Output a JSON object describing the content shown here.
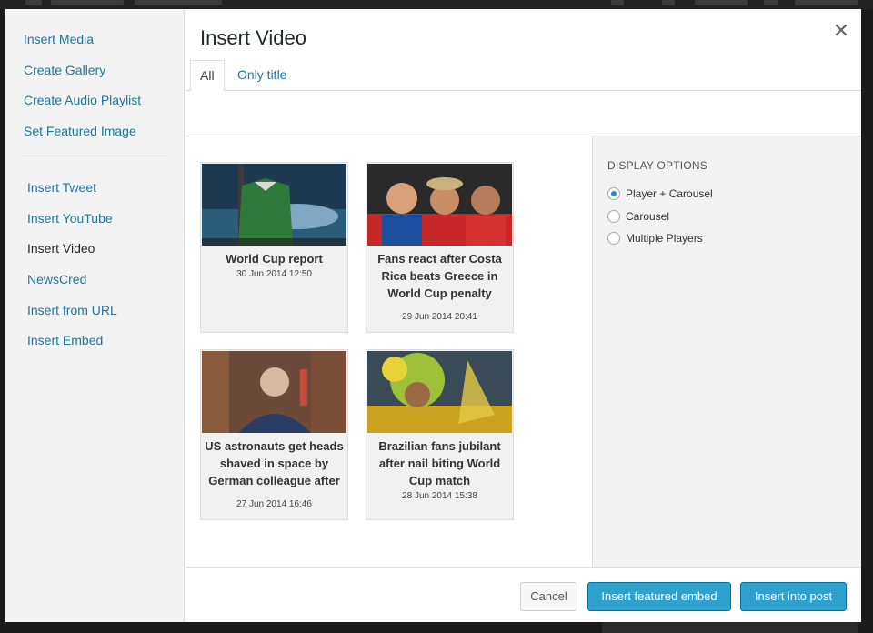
{
  "sidebar": {
    "group1": [
      {
        "id": "insert-media",
        "label": "Insert Media"
      },
      {
        "id": "create-gallery",
        "label": "Create Gallery"
      },
      {
        "id": "create-audio-playlist",
        "label": "Create Audio Playlist"
      },
      {
        "id": "set-featured-image",
        "label": "Set Featured Image"
      }
    ],
    "group2": [
      {
        "id": "insert-tweet",
        "label": "Insert Tweet"
      },
      {
        "id": "insert-youtube",
        "label": "Insert YouTube"
      },
      {
        "id": "insert-video",
        "label": "Insert Video",
        "active": true
      },
      {
        "id": "newscred",
        "label": "NewsCred"
      },
      {
        "id": "insert-from-url",
        "label": "Insert from URL"
      },
      {
        "id": "insert-embed",
        "label": "Insert Embed"
      }
    ]
  },
  "header": {
    "title": "Insert Video",
    "close_icon": "close-icon"
  },
  "tabs": [
    {
      "label": "All",
      "active": true
    },
    {
      "label": "Only title",
      "active": false
    }
  ],
  "videos": [
    {
      "title": "World Cup report",
      "date": "30 Jun 2014 12:50"
    },
    {
      "title": "Fans react after Costa Rica beats Greece in World Cup penalty shoot out",
      "date": "29 Jun 2014 20:41"
    },
    {
      "title": "US astronauts get heads shaved in space by German colleague after losing World Cup bet",
      "date": "27 Jun 2014 16:46"
    },
    {
      "title": "Brazilian fans jubilant after nail biting World Cup match",
      "date": "28 Jun 2014 15:38"
    }
  ],
  "display_options": {
    "heading": "Display Options",
    "options": [
      {
        "label": "Player + Carousel",
        "selected": true
      },
      {
        "label": "Carousel",
        "selected": false
      },
      {
        "label": "Multiple Players",
        "selected": false
      }
    ]
  },
  "footer": {
    "cancel_label": "Cancel",
    "featured_label": "Insert featured embed",
    "insert_label": "Insert into post"
  },
  "colors": {
    "accent": "#2ea2cc",
    "link": "#21759b"
  }
}
